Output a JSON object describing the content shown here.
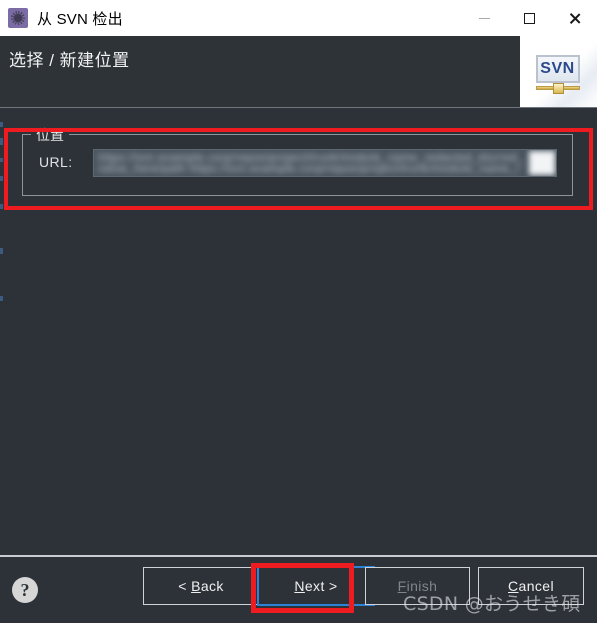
{
  "window": {
    "title": "从 SVN 检出",
    "icon": "svn-repository-icon",
    "controls": [
      {
        "name": "minimize",
        "glyph": "minimize-icon"
      },
      {
        "name": "maximize",
        "glyph": "maximize-icon"
      },
      {
        "name": "close",
        "glyph": "close-icon"
      }
    ]
  },
  "header": {
    "title": "选择 / 新建位置",
    "logo_text": "SVN",
    "logo_icon": "svn-logo-icon"
  },
  "location_group": {
    "legend": "位置",
    "url_label": "URL:",
    "url_value": "https://svn.example.corp/repos/project/trunk/module_name_redacted_blurred_value_here/path",
    "url_placeholder": "",
    "dropdown_icon": "chevron-down-icon"
  },
  "footer": {
    "help_icon": "help-icon",
    "help_glyph": "?",
    "buttons": [
      {
        "id": "back",
        "label": "< Back",
        "mnemonic": "B",
        "enabled": true,
        "focused": false
      },
      {
        "id": "next",
        "label": "Next >",
        "mnemonic": "N",
        "enabled": true,
        "focused": true
      },
      {
        "id": "finish",
        "label": "Finish",
        "mnemonic": "F",
        "enabled": false,
        "focused": false
      },
      {
        "id": "cancel",
        "label": "Cancel",
        "mnemonic": "C",
        "enabled": true,
        "focused": false
      }
    ]
  },
  "watermark": {
    "text": "CSDN @おうせき碩"
  },
  "annotations": [
    {
      "name": "location-highlight",
      "color": "#ee1b21"
    },
    {
      "name": "next-button-highlight",
      "color": "#ee1b21"
    }
  ],
  "colors": {
    "dialog_background": "#2d3238",
    "titlebar_background": "#ffffff",
    "accent_focus": "#2c82d6",
    "annotation_red": "#ee1b21",
    "disabled_text": "#7e858c"
  }
}
